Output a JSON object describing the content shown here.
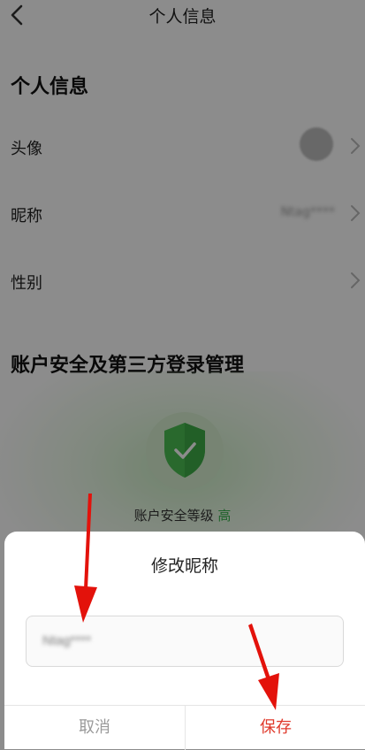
{
  "header": {
    "title": "个人信息",
    "back_icon": "chevron-left-icon"
  },
  "section_profile": {
    "title": "个人信息",
    "rows": [
      {
        "label": "头像",
        "value": ""
      },
      {
        "label": "昵称",
        "value": "Ntag****"
      },
      {
        "label": "性别",
        "value": ""
      }
    ]
  },
  "section_security": {
    "title": "账户安全及第三方登录管理",
    "label": "账户安全等级",
    "level": "高",
    "level_color": "#37b24d"
  },
  "dialog": {
    "title": "修改昵称",
    "input_value": "Ntag****",
    "cancel_label": "取消",
    "save_label": "保存"
  },
  "colors": {
    "accent_save": "#e0392b",
    "annotation_arrow": "#e3120b"
  }
}
